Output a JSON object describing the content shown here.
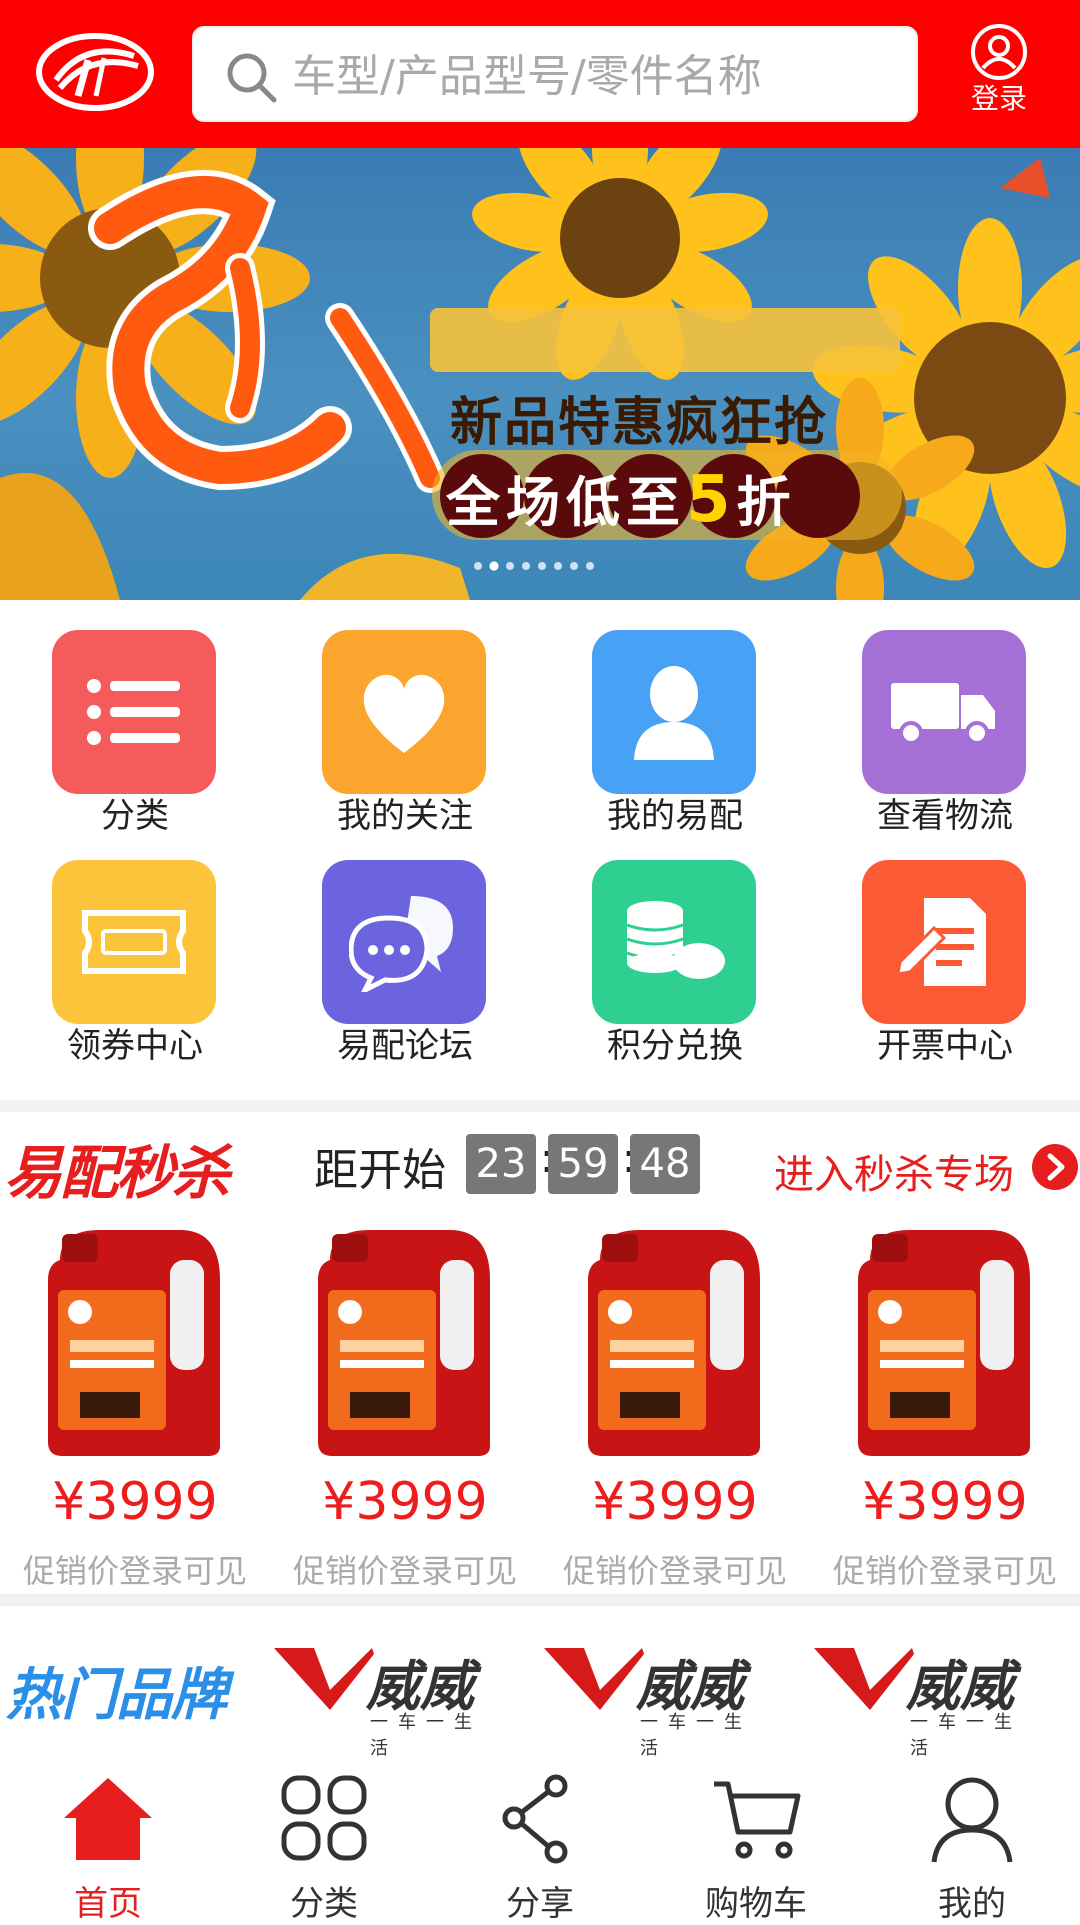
{
  "header": {
    "search_placeholder": "车型/产品型号/零件名称",
    "login_label": "登录"
  },
  "banner": {
    "line1": "新品特惠疯狂抢",
    "line2_prefix": "全场低至",
    "line2_number": "5",
    "line2_suffix": "折",
    "slide_count": 8,
    "active_slide": 2
  },
  "quick_links": [
    {
      "label": "分类",
      "icon": "list-icon",
      "color": "#f55b5b"
    },
    {
      "label": "我的关注",
      "icon": "heart-icon",
      "color": "#fba52e"
    },
    {
      "label": "我的易配",
      "icon": "user-icon",
      "color": "#47a2f6"
    },
    {
      "label": "查看物流",
      "icon": "truck-icon",
      "color": "#a571d6"
    },
    {
      "label": "领券中心",
      "icon": "coupon-icon",
      "color": "#fbc43b"
    },
    {
      "label": "易配论坛",
      "icon": "chat-icon",
      "color": "#6c63de"
    },
    {
      "label": "积分兑换",
      "icon": "coins-icon",
      "color": "#2ecf90"
    },
    {
      "label": "开票中心",
      "icon": "invoice-icon",
      "color": "#fc5a34"
    }
  ],
  "flash_sale": {
    "title": "易配秒杀",
    "countdown_label": "距开始",
    "hours": "23",
    "minutes": "59",
    "seconds": "48",
    "more_label": "进入秒杀专场",
    "products": [
      {
        "price": "¥3999",
        "note": "促销价登录可见"
      },
      {
        "price": "¥3999",
        "note": "促销价登录可见"
      },
      {
        "price": "¥3999",
        "note": "促销价登录可见"
      },
      {
        "price": "¥3999",
        "note": "促销价登录可见"
      }
    ]
  },
  "brands": {
    "title": "热门品牌",
    "items": [
      {
        "name": "威威",
        "tagline": "一车一生活"
      },
      {
        "name": "威威",
        "tagline": "一车一生活"
      },
      {
        "name": "威威",
        "tagline": "一车一生活"
      }
    ]
  },
  "tabbar": {
    "items": [
      {
        "label": "首页",
        "active": true
      },
      {
        "label": "分类",
        "active": false
      },
      {
        "label": "分享",
        "active": false
      },
      {
        "label": "购物车",
        "active": false
      },
      {
        "label": "我的",
        "active": false
      }
    ]
  },
  "colors": {
    "header_bg": "#ff0000",
    "accent": "#e61e1e",
    "brand_blue": "#2b8fe8"
  }
}
